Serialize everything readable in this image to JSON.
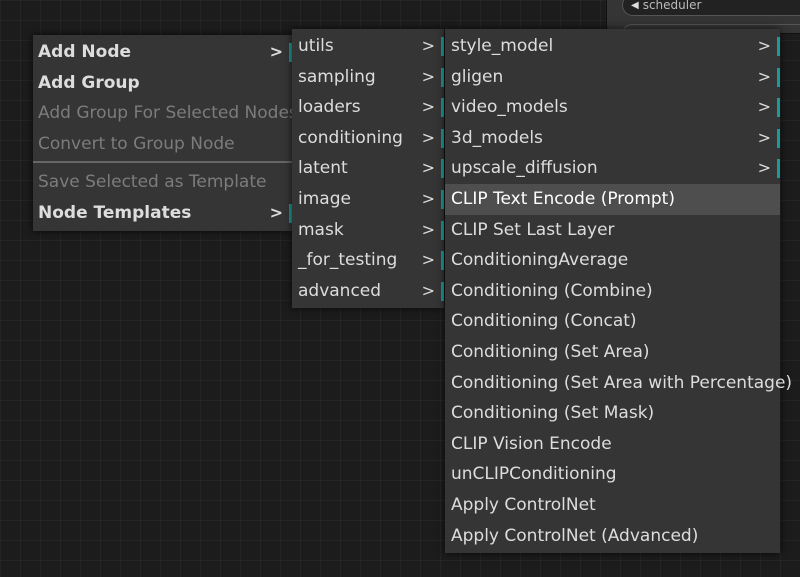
{
  "background_node": {
    "widget_label": "scheduler",
    "arrow_icon": "triangle-left-icon"
  },
  "main_menu": {
    "items": [
      {
        "label": "Add Node",
        "submenu": true,
        "disabled": false
      },
      {
        "label": "Add Group",
        "submenu": false,
        "disabled": false
      },
      {
        "label": "Add Group For Selected Nodes",
        "submenu": false,
        "disabled": true
      },
      {
        "label": "Convert to Group Node",
        "submenu": false,
        "disabled": true
      },
      {
        "label": "Save Selected as Template",
        "submenu": false,
        "disabled": true
      },
      {
        "label": "Node Templates",
        "submenu": true,
        "disabled": false
      }
    ],
    "arrow": ">"
  },
  "category_menu": {
    "items": [
      {
        "label": "utils"
      },
      {
        "label": "sampling"
      },
      {
        "label": "loaders"
      },
      {
        "label": "conditioning"
      },
      {
        "label": "latent"
      },
      {
        "label": "image"
      },
      {
        "label": "mask"
      },
      {
        "label": "_for_testing"
      },
      {
        "label": "advanced"
      }
    ],
    "arrow": ">"
  },
  "conditioning_menu": {
    "subcategories": [
      {
        "label": "style_model"
      },
      {
        "label": "gligen"
      },
      {
        "label": "video_models"
      },
      {
        "label": "3d_models"
      },
      {
        "label": "upscale_diffusion"
      }
    ],
    "nodes": [
      {
        "label": "CLIP Text Encode (Prompt)",
        "highlighted": true
      },
      {
        "label": "CLIP Set Last Layer"
      },
      {
        "label": "ConditioningAverage"
      },
      {
        "label": "Conditioning (Combine)"
      },
      {
        "label": "Conditioning (Concat)"
      },
      {
        "label": "Conditioning (Set Area)"
      },
      {
        "label": "Conditioning (Set Area with Percentage)"
      },
      {
        "label": "Conditioning (Set Mask)"
      },
      {
        "label": "CLIP Vision Encode"
      },
      {
        "label": "unCLIPConditioning"
      },
      {
        "label": "Apply ControlNet"
      },
      {
        "label": "Apply ControlNet (Advanced)"
      }
    ],
    "arrow": ">"
  },
  "colors": {
    "menu_bg": "#353535",
    "highlight_bg": "#4e4e4e",
    "submenu_indicator": "#1b9a9a",
    "text": "#dddddd",
    "disabled_text": "#7c7c7c"
  }
}
